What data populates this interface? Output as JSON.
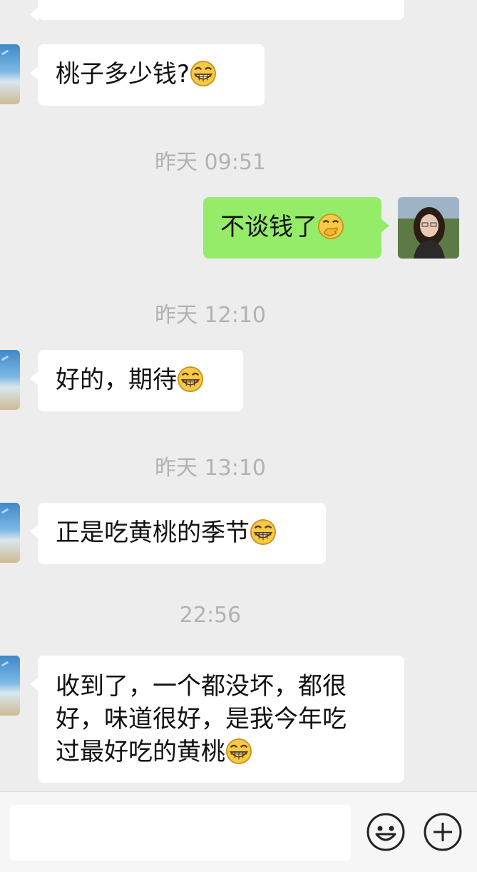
{
  "messages": [
    {
      "type": "in",
      "text": "桃子多少钱?",
      "emoji": "grin-emoji"
    },
    {
      "type": "timestamp",
      "text": "昨天 09:51"
    },
    {
      "type": "out",
      "text": "不谈钱了",
      "emoji": "hand-over-mouth-emoji"
    },
    {
      "type": "timestamp",
      "text": "昨天 12:10"
    },
    {
      "type": "in",
      "text": "好的，期待",
      "emoji": "grin-emoji"
    },
    {
      "type": "timestamp",
      "text": "昨天 13:10"
    },
    {
      "type": "in",
      "text": "正是吃黄桃的季节",
      "emoji": "grin-emoji"
    },
    {
      "type": "timestamp",
      "text": "22:56"
    },
    {
      "type": "in",
      "lines": [
        "收到了，一个都没坏，都很",
        "好，味道很好，是我今年吃",
        "过最好吃的黄桃"
      ],
      "emoji": "grin-emoji"
    }
  ],
  "input": {
    "placeholder": ""
  },
  "icons": {
    "emoji_button": "smiley-face-icon",
    "more_button": "plus-circle-icon"
  },
  "colors": {
    "background": "#ededed",
    "incoming_bubble": "#ffffff",
    "outgoing_bubble": "#95ec69",
    "timestamp": "#b2b2b2"
  }
}
